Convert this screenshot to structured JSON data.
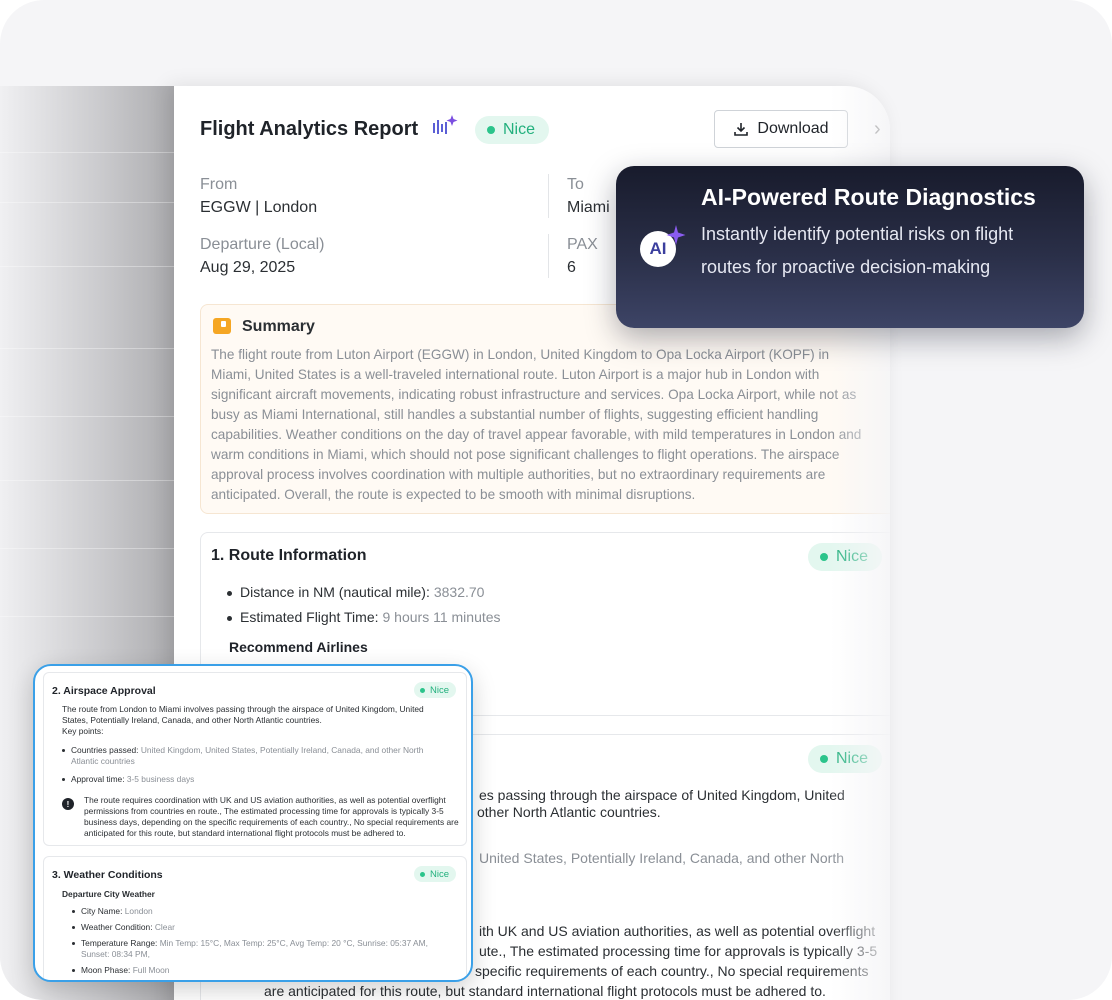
{
  "report": {
    "title": "Flight Analytics Report",
    "status_badge": "Nice",
    "download_label": "Download",
    "from": {
      "label": "From",
      "value": "EGGW | London"
    },
    "to": {
      "label": "To",
      "value": "Miami"
    },
    "departure": {
      "label": "Departure (Local)",
      "value": "Aug 29, 2025"
    },
    "pax": {
      "label": "PAX",
      "value": "6"
    },
    "summary": {
      "title": "Summary",
      "text": "The flight route from Luton Airport (EGGW) in London, United Kingdom to Opa Locka Airport (KOPF) in Miami, United States is a well-traveled international route. Luton Airport is a major hub in London with significant aircraft movements, indicating robust infrastructure and services. Opa Locka Airport, while not as busy as Miami International, still handles a substantial number of flights, suggesting efficient handling capabilities. Weather conditions on the day of travel appear favorable, with mild temperatures in London and warm conditions in Miami, which should not pose significant challenges to flight operations. The airspace approval process involves coordination with multiple authorities, but no extraordinary requirements are anticipated. Overall, the route is expected to be smooth with minimal disruptions."
    },
    "route_info": {
      "title": "1. Route Information",
      "badge": "Nice",
      "distance_label": "Distance in NM (nautical mile):",
      "distance_value": "3832.70",
      "time_label": "Estimated Flight Time:",
      "time_value": "9 hours 11 minutes",
      "airlines_heading": "Recommend Airlines"
    },
    "section2_partial": {
      "badge": "Nice",
      "line1": "es passing through the airspace of United Kingdom, United",
      "line2": "other North Atlantic countries.",
      "line3": "United States, Potentially Ireland, Canada, and other North",
      "line4": "ith UK and US aviation authorities, as well as potential overflight",
      "line5": "ute., The estimated processing time for approvals is typically 3-5",
      "line6": "specific requirements of each country., No special requirements",
      "line7": "are anticipated for this route, but standard international flight protocols must be adhered to."
    }
  },
  "ai_card": {
    "avatar": "AI",
    "title": "AI-Powered Route Diagnostics",
    "description": "Instantly identify potential risks on flight routes for proactive decision-making"
  },
  "mini": {
    "airspace": {
      "title": "2. Airspace Approval",
      "badge": "Nice",
      "intro": "The route from London to Miami involves passing through the airspace of United Kingdom, United States, Potentially Ireland, Canada, and other North Atlantic countries.",
      "key_points": "Key points:",
      "countries_label": "Countries passed:",
      "countries_value": "United Kingdom, United States, Potentially Ireland, Canada, and other North Atlantic countries",
      "approval_label": "Approval time:",
      "approval_value": "3-5 business days",
      "note": "The route requires coordination with UK and US aviation authorities, as well as potential overflight permissions from countries en route., The estimated processing time for approvals is typically 3-5 business days, depending on the specific requirements of each country., No special requirements are anticipated for this route, but standard international flight protocols must be adhered to."
    },
    "weather": {
      "title": "3. Weather Conditions",
      "badge": "Nice",
      "heading": "Departure City Weather",
      "city_label": "City Name:",
      "city_value": "London",
      "condition_label": "Weather Condition:",
      "condition_value": "Clear",
      "temp_label": "Temperature Range:",
      "temp_value": "Min Temp: 15°C, Max Temp: 25°C, Avg Temp: 20 °C, Sunrise: 05:37 AM, Sunset: 08:34 PM,",
      "moon_label": "Moon Phase:",
      "moon_value": "Full Moon"
    }
  },
  "colors": {
    "nice_green": "#22b07d",
    "ai_card_bg": "#1e2236",
    "mini_border": "#3aa0e8",
    "summary_bg": "#fffaf4"
  }
}
